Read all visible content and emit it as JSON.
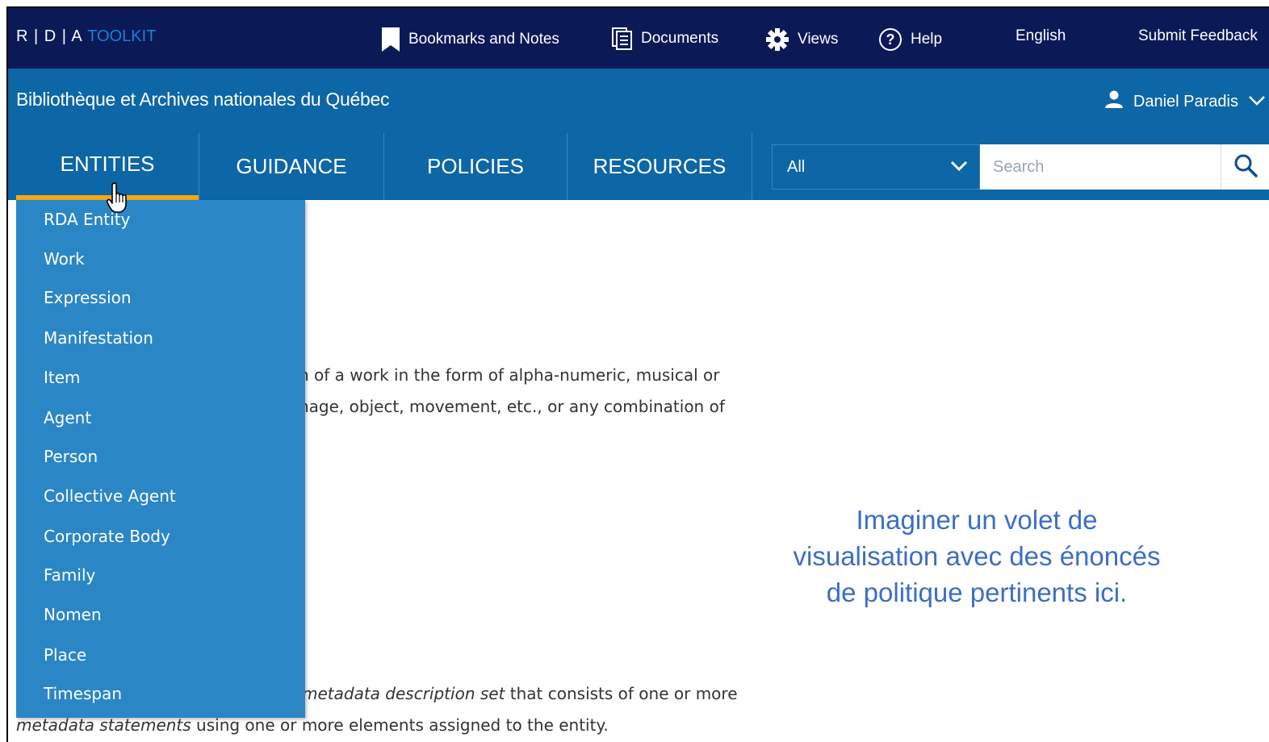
{
  "topbar": {
    "logo_main": "R | D | A ",
    "logo_toolkit": "TOOLKIT",
    "bookmarks": "Bookmarks and Notes",
    "documents": "Documents",
    "views": "Views",
    "help": "Help",
    "language": "English",
    "feedback": "Submit Feedback"
  },
  "subheader": {
    "institution": "Bibliothèque et Archives nationales du Québec",
    "user": "Daniel Paradis"
  },
  "nav": {
    "tabs": [
      {
        "label": "ENTITIES",
        "active": true
      },
      {
        "label": "GUIDANCE"
      },
      {
        "label": "POLICIES"
      },
      {
        "label": "RESOURCES"
      }
    ]
  },
  "search": {
    "scope": "All",
    "placeholder": "Search"
  },
  "dropdown": {
    "items": [
      "RDA Entity",
      "Work",
      "Expression",
      "Manifestation",
      "Item",
      "Agent",
      "Person",
      "Collective Agent",
      "Corporate Body",
      "Family",
      "Nomen",
      "Place",
      "Timespan"
    ]
  },
  "content": {
    "line1": "n of a work in the form of alpha-numeric, musical or",
    "line2": "nage, object, movement, etc., or any combination of",
    "line3_em": "metadata description set",
    "line3_rest": " that consists of one or more",
    "line4_em": "metadata statements",
    "line4_rest": " using one or more elements assigned to the entity."
  },
  "note": {
    "line1": "Imaginer un volet de",
    "line2": "visualisation avec des énoncés",
    "line3": "de politique pertinents ici."
  },
  "colors": {
    "topbar": "#0b1957",
    "subheader": "#0d66a6",
    "dropdown": "#2b86c6",
    "active_tab_underline": "#f4a817",
    "toolkit_text": "#1f7fd1",
    "note_text": "#3c6ec6"
  }
}
